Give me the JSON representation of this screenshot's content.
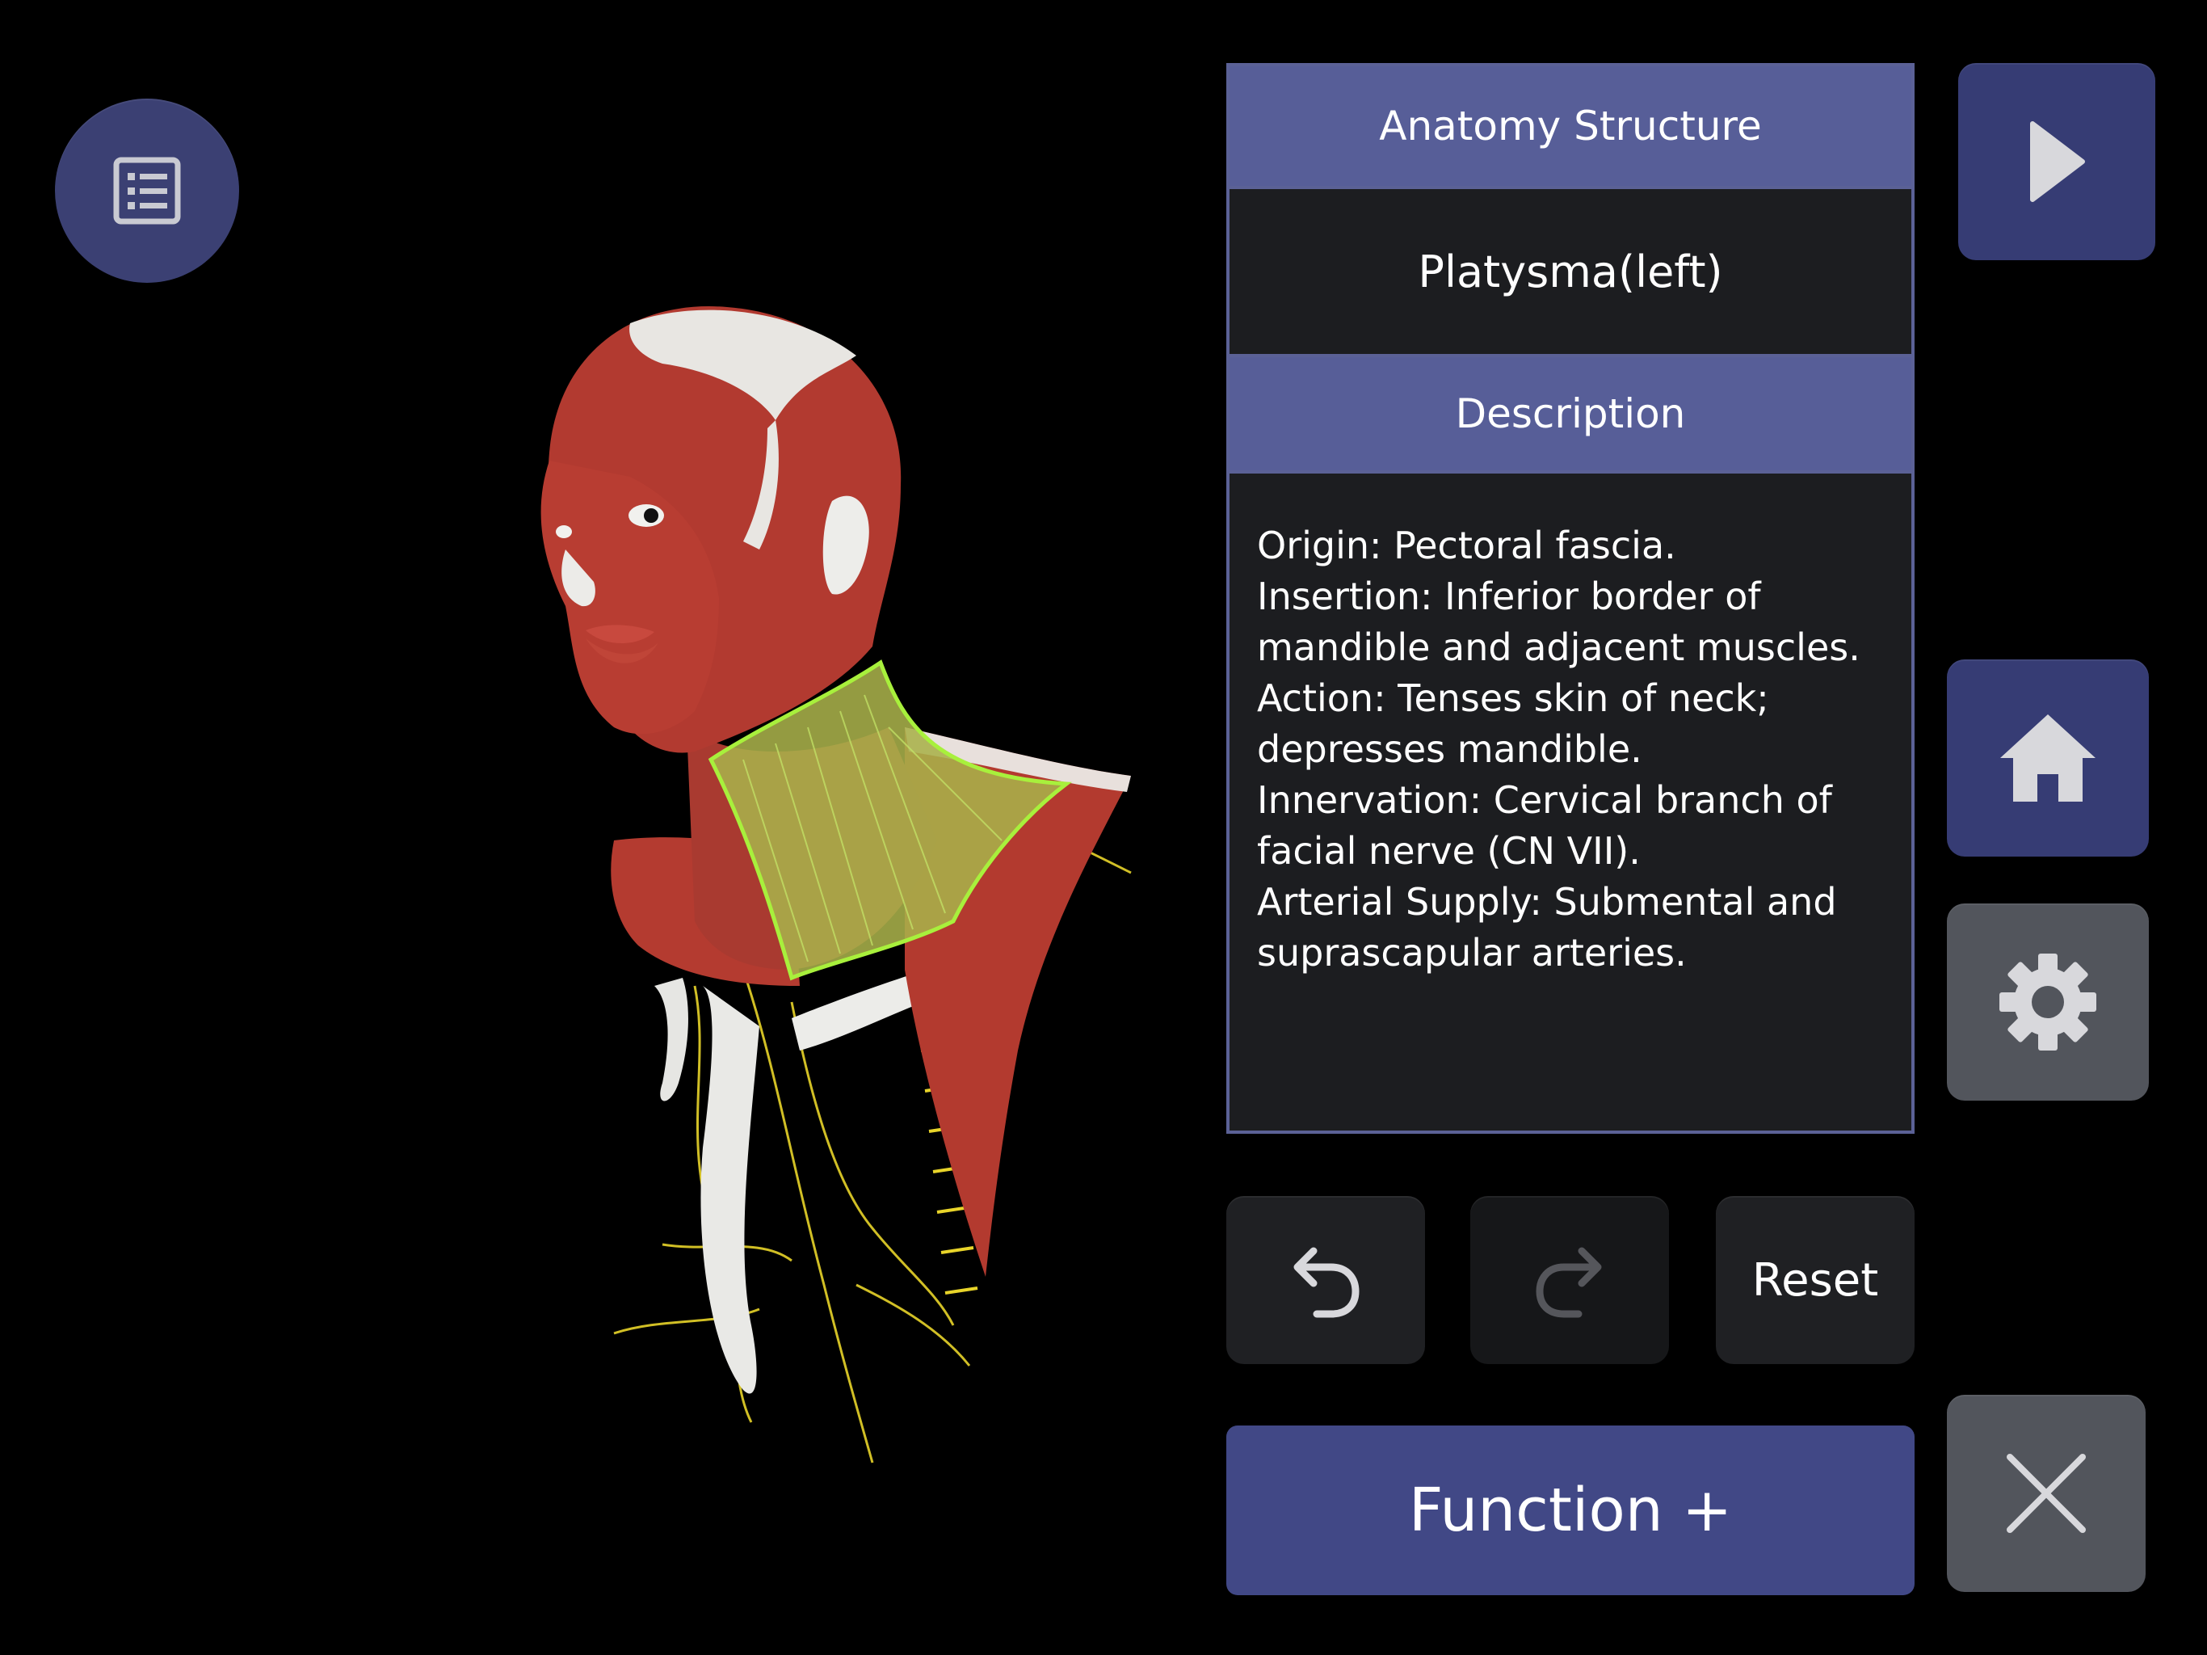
{
  "viewport": {
    "model_name": "3d-anatomy-model-head-neck"
  },
  "menu_button": {
    "icon": "list-icon"
  },
  "panel": {
    "structure_header": "Anatomy Structure",
    "structure_name": "Platysma(left)",
    "description_header": "Description",
    "description_lines": [
      "Origin: Pectoral fascia.",
      "Insertion: Inferior border of",
      "mandible and adjacent muscles.",
      "Action: Tenses skin of neck;",
      "depresses mandible.",
      "Innervation: Cervical branch of",
      "facial nerve (CN VII).",
      "Arterial Supply: Submental and",
      "suprascapular arteries."
    ]
  },
  "controls": {
    "play_icon": "play-icon",
    "home_icon": "home-icon",
    "settings_icon": "gear-icon",
    "undo_icon": "undo-icon",
    "redo_icon": "redo-icon",
    "reset_label": "Reset",
    "function_label": "Function +",
    "close_icon": "close-icon"
  },
  "colors": {
    "navy_button": "#363c74",
    "panel_header": "#575e98",
    "panel_body": "#1c1d20",
    "highlight": "#a8f03c"
  }
}
